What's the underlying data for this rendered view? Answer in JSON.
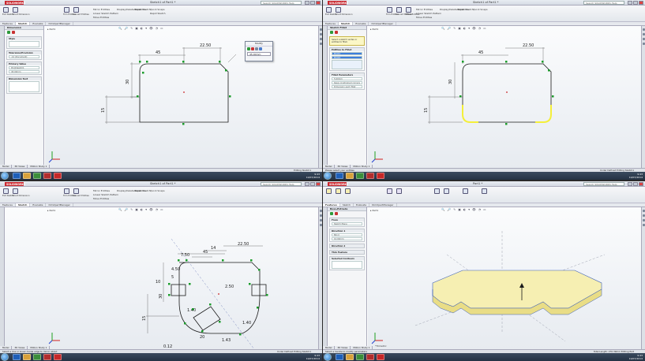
{
  "app": {
    "logo": "SOLIDWORKS",
    "search_placeholder": "Search SOLIDWORKS Help"
  },
  "quadrants": [
    {
      "id": "q1",
      "title": "Sketch1 of Part1 *",
      "tabs": [
        "Features",
        "Sketch",
        "Evaluate",
        "DimXpertManager"
      ],
      "active_tab": "Sketch",
      "pane": {
        "title": "Dimension",
        "sections": [
          {
            "title": "Style",
            "rows": []
          },
          {
            "title": "Tolerance/Precision",
            "rows": [
              ".12 (Document)"
            ]
          },
          {
            "title": "Primary Value",
            "rows": [
              "D1@Sketch1",
              "45.00mm"
            ]
          },
          {
            "title": "Dimension Text",
            "rows": []
          }
        ]
      },
      "modify_dialog": {
        "title": "Modify",
        "value": "45.00mm"
      },
      "dimensions": [
        "45",
        "22.50",
        "30",
        "15"
      ],
      "status_left": "Under Defined",
      "status_right": "Editing Sketch1",
      "model_tabs": [
        "Model",
        "3D Views",
        "Motion Study 1"
      ]
    },
    {
      "id": "q2",
      "title": "Sketch1 of Part1 *",
      "tabs": [
        "Features",
        "Sketch",
        "Evaluate",
        "DimXpertManager"
      ],
      "active_tab": "Sketch",
      "pane": {
        "title": "Sketch Fillet",
        "message": "Select a sketch vertex or entities to fillet.",
        "sections": [
          {
            "title": "Entities to Fillet",
            "rows": [
              "Point1",
              "Point2"
            ],
            "selected": [
              0,
              1
            ]
          },
          {
            "title": "Fillet Parameters",
            "rows": [
              "5.00mm",
              "Keep constrained corners",
              "Dimension each fillet"
            ]
          }
        ]
      },
      "dimensions": [
        "45",
        "22.50",
        "30",
        "15"
      ],
      "status_left": "Please select your entities",
      "status_right": "Under Defined  Editing Sketch1",
      "model_tabs": [
        "Model",
        "3D Views",
        "Motion Study 1"
      ]
    },
    {
      "id": "q3",
      "title": "Sketch1 of Part1 *",
      "tabs": [
        "Features",
        "Sketch",
        "Evaluate",
        "DimXpertManager"
      ],
      "active_tab": "Sketch",
      "dimensions": [
        "14",
        "7.50",
        "22.50",
        "45",
        "4.50",
        "5",
        "10",
        "30",
        "15",
        "2.50",
        "20",
        "1.40",
        "0.12",
        "1.40",
        "1.43"
      ],
      "status_left": "Select a line or linear model edge to mirror about",
      "status_right": "Under Defined  Editing Sketch1",
      "model_tabs": [
        "Model",
        "3D Views",
        "Motion Study 1"
      ]
    },
    {
      "id": "q4",
      "title": "Part1 *",
      "tabs": [
        "Features",
        "Sketch",
        "Evaluate",
        "DimXpertManager"
      ],
      "active_tab": "Features",
      "pane": {
        "title": "Boss-Extrude",
        "sections": [
          {
            "title": "From",
            "rows": [
              "Sketch Plane"
            ]
          },
          {
            "title": "Direction 1",
            "rows": [
              "Blind",
              "10.00mm"
            ]
          },
          {
            "title": "Direction 2",
            "rows": []
          },
          {
            "title": "Thin Feature",
            "rows": []
          },
          {
            "title": "Selected Contours",
            "rows": []
          }
        ]
      },
      "view_label": "*Trimetric",
      "status_left": "Select a handle to modify parameters",
      "status_right": "Total Length: 270.39mm  Editing Part",
      "model_tabs": [
        "Model",
        "3D Views",
        "Motion Study 1"
      ]
    }
  ],
  "ribbon": {
    "buttons": [
      "Exit Sketch",
      "Smart Dimension",
      "Trim Entities",
      "Convert Entities",
      "Offset Entities"
    ],
    "text_items": [
      "Mirror Entities",
      "Linear Sketch Pattern",
      "Move Entities",
      "Display/Delete Relations",
      "Repair Sketch",
      "Quick Snaps",
      "Rapid Sketch"
    ]
  },
  "view_toolbar": "🔍 🔎 ✎ ▣ ◐ ▾ 👁 ◔ ▭",
  "taskbar": {
    "clock_time": "9:43",
    "clock_date": "10/07/2014"
  },
  "colors": {
    "sketch_line": "#1a1a1a",
    "relation_green": "#1a9c2a",
    "fillet_yellow": "#f4ef3a",
    "extrude_fill": "#f6efb2",
    "accent": "#2a79c6"
  }
}
